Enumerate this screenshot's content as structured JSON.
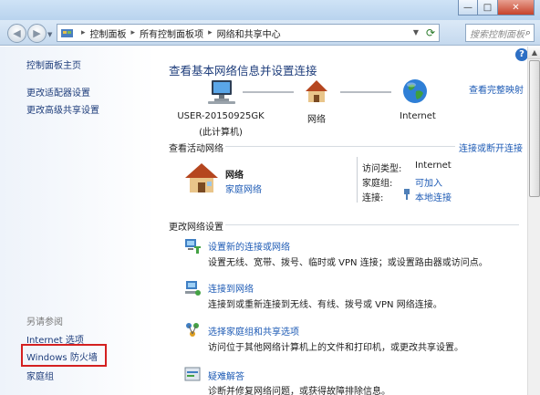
{
  "window": {
    "controls": {
      "minimize": "—",
      "maximize": "□",
      "close": "✕"
    }
  },
  "navbar": {
    "breadcrumb": [
      "控制面板",
      "所有控制面板项",
      "网络和共享中心"
    ],
    "search_placeholder": "搜索控制面板"
  },
  "sidebar": {
    "links": [
      "控制面板主页",
      "更改适配器设置",
      "更改高级共享设置"
    ],
    "see_also_heading": "另请参阅",
    "see_also": [
      "Internet 选项",
      "Windows 防火墙",
      "家庭组"
    ],
    "highlight_color": "#d42020"
  },
  "main": {
    "title": "查看基本网络信息并设置连接",
    "view_full_map": "查看完整映射",
    "map": {
      "computer_name": "USER-20150925GK",
      "computer_sub": "(此计算机)",
      "network_label": "网络",
      "internet_label": "Internet"
    },
    "active_networks": {
      "heading": "查看活动网络",
      "action": "连接或断开连接",
      "network_name": "网络",
      "network_type": "家庭网络",
      "access_type_label": "访问类型:",
      "access_type_value": "Internet",
      "homegroup_label": "家庭组:",
      "homegroup_value": "可加入",
      "connection_label": "连接:",
      "connection_value": "本地连接"
    },
    "change_settings": {
      "heading": "更改网络设置",
      "items": [
        {
          "link": "设置新的连接或网络",
          "desc": "设置无线、宽带、拨号、临时或 VPN 连接；或设置路由器或访问点。"
        },
        {
          "link": "连接到网络",
          "desc": "连接到或重新连接到无线、有线、拨号或 VPN 网络连接。"
        },
        {
          "link": "选择家庭组和共享选项",
          "desc": "访问位于其他网络计算机上的文件和打印机，或更改共享设置。"
        },
        {
          "link": "疑难解答",
          "desc": "诊断并修复网络问题，或获得故障排除信息。"
        }
      ]
    }
  },
  "colors": {
    "link": "#1e5bb5",
    "title": "#1e3d7b"
  }
}
